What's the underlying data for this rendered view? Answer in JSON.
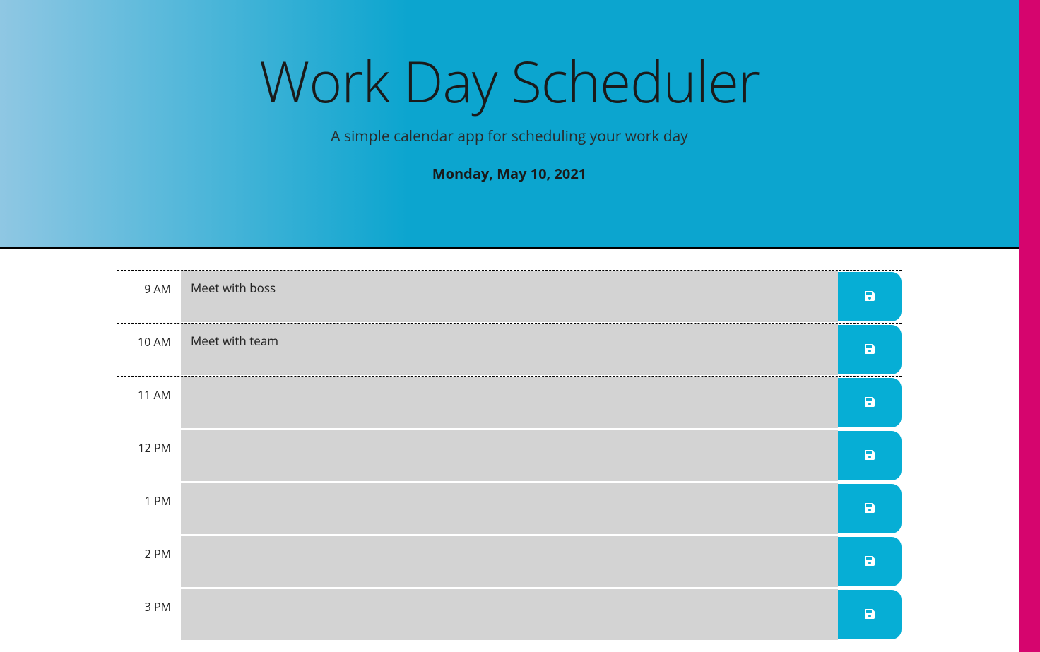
{
  "header": {
    "title": "Work Day Scheduler",
    "subtitle": "A simple calendar app for scheduling your work day",
    "date": "Monday, May 10, 2021"
  },
  "rows": [
    {
      "hour": "9 AM",
      "task": "Meet with boss"
    },
    {
      "hour": "10 AM",
      "task": "Meet with team"
    },
    {
      "hour": "11 AM",
      "task": ""
    },
    {
      "hour": "12 PM",
      "task": ""
    },
    {
      "hour": "1 PM",
      "task": ""
    },
    {
      "hour": "2 PM",
      "task": ""
    },
    {
      "hour": "3 PM",
      "task": ""
    }
  ],
  "colors": {
    "accent": "#06aed5",
    "headerGradientStart": "#8fc7e3",
    "headerGradientEnd": "#0ca5cf",
    "pageBorder": "#d6056e",
    "past": "#d3d3d3"
  },
  "icons": {
    "save": "save-icon"
  }
}
